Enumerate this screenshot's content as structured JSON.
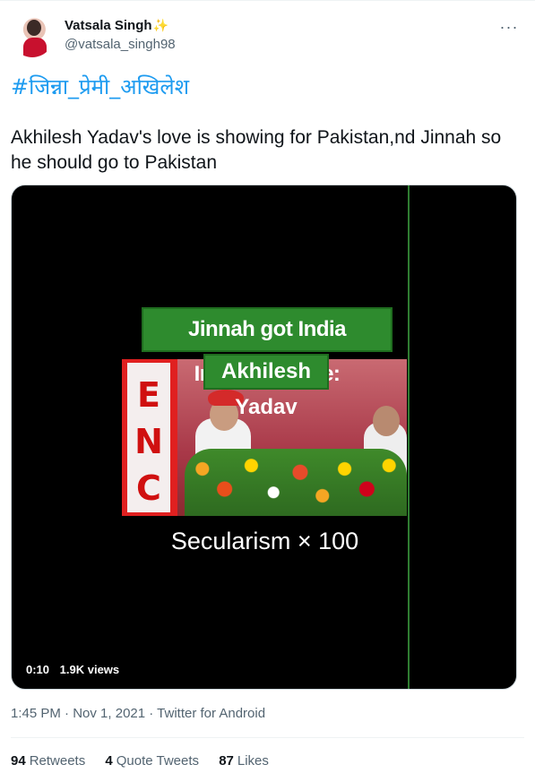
{
  "author": {
    "name": "Vatsala Singh",
    "name_emoji": "✨",
    "handle": "@vatsala_singh98"
  },
  "more_icon": "more-horizontal-icon",
  "tweet": {
    "hashtag": "#जिन्ना_प्रेमी_अखिलेश",
    "text": "Akhilesh Yadav's love is showing for Pakistan,nd Jinnah so he should go to Pakistan"
  },
  "media": {
    "caption_line1": "Jinnah got India Independence:",
    "caption_line2": "Akhilesh Yadav",
    "sign_letters": "ENC",
    "subtitle": "Secularism × 100",
    "duration": "0:10",
    "views": "1.9K views"
  },
  "meta": {
    "time": "1:45 PM",
    "date": "Nov 1, 2021",
    "source": "Twitter for Android",
    "separator": " · "
  },
  "stats": {
    "retweets_count": "94",
    "retweets_label": "Retweets",
    "quotes_count": "4",
    "quotes_label": "Quote Tweets",
    "likes_count": "87",
    "likes_label": "Likes"
  },
  "colors": {
    "link_blue": "#1d9bf0",
    "secondary_text": "#536471",
    "caption_green": "#2e8b2e"
  }
}
